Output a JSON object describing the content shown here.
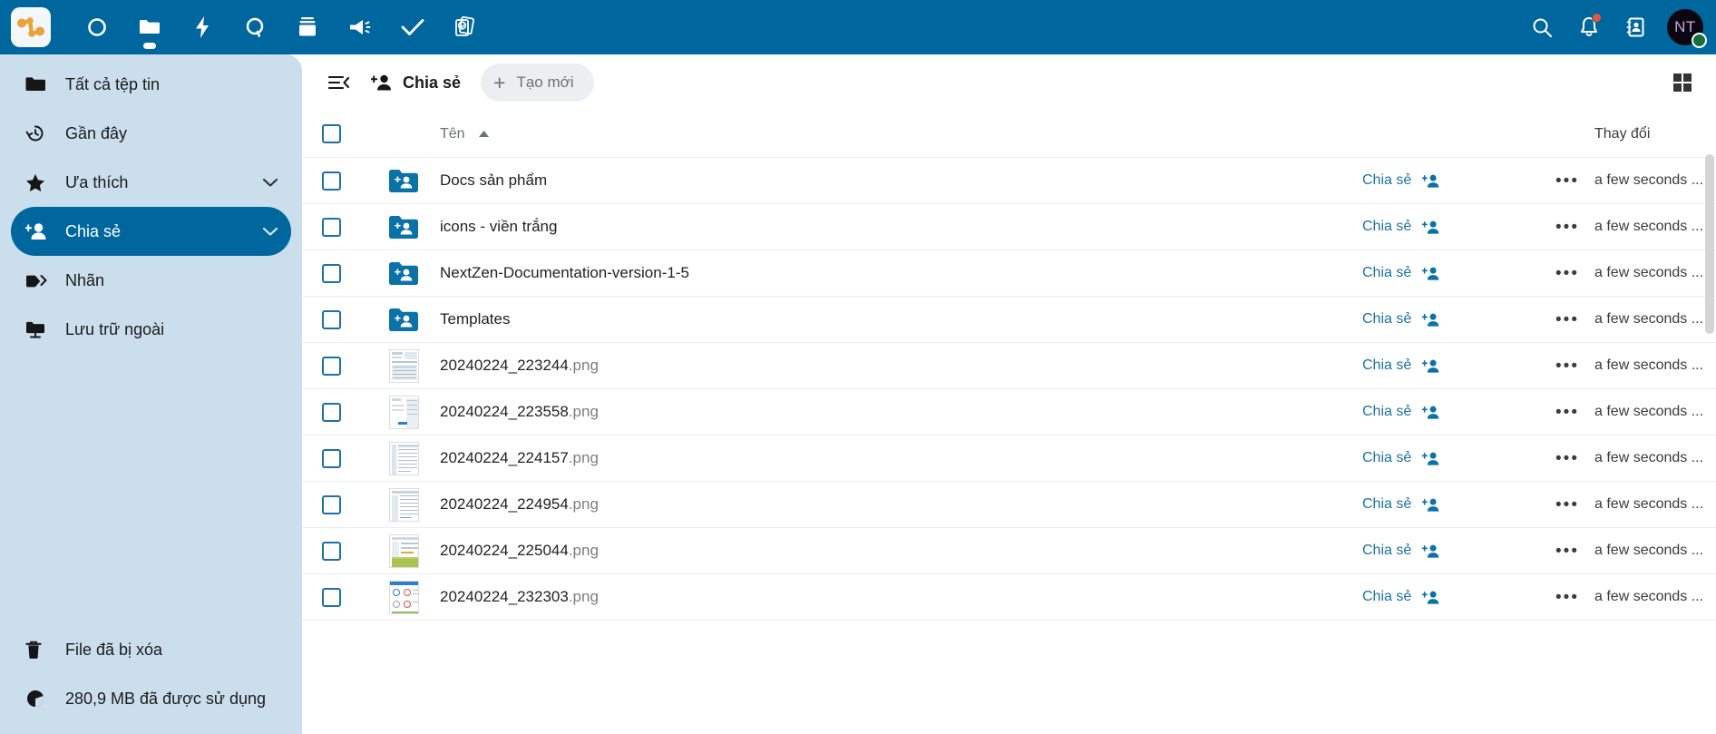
{
  "colors": {
    "header_blue": "#00679e",
    "sidebar_blue": "#cbdeec",
    "accent": "#1a72a6",
    "logo_orange": "#e8a33d",
    "status_green": "#1a6e3c",
    "badge_red": "#e8543c"
  },
  "topbar": {
    "logo_name": "nextcloud-logo",
    "nav": [
      {
        "name": "dashboard-icon",
        "label": "Dashboard",
        "active": false
      },
      {
        "name": "files-icon",
        "label": "Files",
        "active": true
      },
      {
        "name": "activity-icon",
        "label": "Activity",
        "active": false
      },
      {
        "name": "talk-icon",
        "label": "Talk",
        "active": false
      },
      {
        "name": "archive-icon",
        "label": "Archive",
        "active": false
      },
      {
        "name": "announcement-icon",
        "label": "Announcements",
        "active": false
      },
      {
        "name": "tasks-icon",
        "label": "Tasks",
        "active": false
      },
      {
        "name": "deck-icon",
        "label": "Deck",
        "active": false
      }
    ],
    "right": [
      {
        "name": "search-icon",
        "label": "Search"
      },
      {
        "name": "notifications-bell-icon",
        "label": "Notifications",
        "badge": true
      },
      {
        "name": "contacts-icon",
        "label": "Contacts"
      }
    ],
    "avatar": {
      "initials": "NT",
      "status": "online"
    }
  },
  "sidebar": {
    "items": [
      {
        "label": "Tất cả tệp tin",
        "icon": "folder-icon",
        "active": false,
        "expandable": false
      },
      {
        "label": "Gần đây",
        "icon": "recent-clock-icon",
        "active": false,
        "expandable": false
      },
      {
        "label": "Ưa thích",
        "icon": "star-icon",
        "active": false,
        "expandable": true
      },
      {
        "label": "Chia sẻ",
        "icon": "share-person-icon",
        "active": true,
        "expandable": true
      },
      {
        "label": "Nhãn",
        "icon": "tag-icon",
        "active": false,
        "expandable": false
      },
      {
        "label": "Lưu trữ ngoài",
        "icon": "external-storage-icon",
        "active": false,
        "expandable": false
      }
    ],
    "bottom": [
      {
        "label": "File đã bị xóa",
        "icon": "trash-icon"
      },
      {
        "label": "280,9 MB đã được sử dụng",
        "icon": "pie-chart-icon"
      }
    ]
  },
  "toolbar": {
    "collapse_icon": "collapse-sidebar-icon",
    "breadcrumb_icon": "share-person-icon",
    "breadcrumb_label": "Chia sẻ",
    "new_button_label": "Tạo mới",
    "new_button_plus": "+",
    "grid_toggle_icon": "grid-view-icon"
  },
  "table": {
    "headers": {
      "name": "Tên",
      "sort_direction": "asc",
      "modified": "Thay đổi"
    },
    "row_share_label": "Chia sẻ",
    "row_menu_glyph": "•••",
    "rows": [
      {
        "name": "Docs sản phẩm",
        "ext": "",
        "type": "folder-shared",
        "share": "Chia sẻ",
        "modified": "a few seconds ..."
      },
      {
        "name": "icons - viền trắng",
        "ext": "",
        "type": "folder-shared",
        "share": "Chia sẻ",
        "modified": "a few seconds ..."
      },
      {
        "name": "NextZen-Documentation-version-1-5",
        "ext": "",
        "type": "folder-shared",
        "share": "Chia sẻ",
        "modified": "a few seconds ..."
      },
      {
        "name": "Templates",
        "ext": "",
        "type": "folder-shared",
        "share": "Chia sẻ",
        "modified": "a few seconds ..."
      },
      {
        "name": "20240224_223244",
        "ext": ".png",
        "type": "image",
        "share": "Chia sẻ",
        "modified": "a few seconds ..."
      },
      {
        "name": "20240224_223558",
        "ext": ".png",
        "type": "image",
        "share": "Chia sẻ",
        "modified": "a few seconds ..."
      },
      {
        "name": "20240224_224157",
        "ext": ".png",
        "type": "image",
        "share": "Chia sẻ",
        "modified": "a few seconds ..."
      },
      {
        "name": "20240224_224954",
        "ext": ".png",
        "type": "image",
        "share": "Chia sẻ",
        "modified": "a few seconds ..."
      },
      {
        "name": "20240224_225044",
        "ext": ".png",
        "type": "image",
        "share": "Chia sẻ",
        "modified": "a few seconds ..."
      },
      {
        "name": "20240224_232303",
        "ext": ".png",
        "type": "image",
        "share": "Chia sẻ",
        "modified": "a few seconds ..."
      }
    ]
  }
}
